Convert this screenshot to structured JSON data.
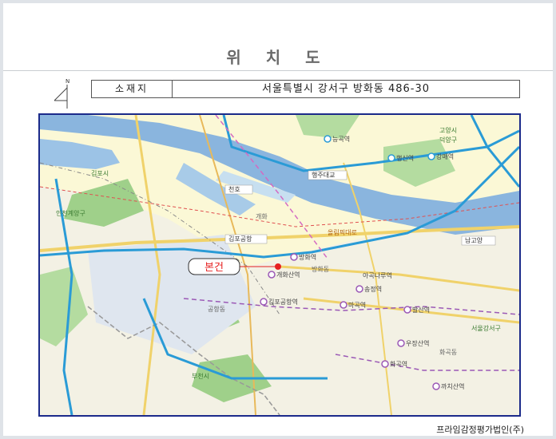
{
  "header": {
    "title": "위 치 도"
  },
  "location": {
    "label": "소재지",
    "address": "서울특별시 강서구 방화동 486-30"
  },
  "north_arrow": {
    "letter": "N",
    "icon": "north-arrow-icon"
  },
  "map": {
    "subject_label": "본건",
    "roads": {
      "olympic": "올림픽대로",
      "haengju_bridge": "행주대교",
      "namgoyang": "남고양",
      "gimpo_airport_ic": "김포공항",
      "cheonho": "천호"
    },
    "stations": [
      "방화역",
      "개화산역",
      "김포공항역",
      "송정역",
      "마곡역",
      "발산역",
      "아곡나루역",
      "우장산역",
      "화곡역",
      "까치산역",
      "능곡역",
      "행신역",
      "강매역"
    ],
    "places": {
      "seoul_gangseo": "서울강서구",
      "incheon_gyeyang": "인천계양구",
      "bucheon": "부천시",
      "gimpo": "김포시",
      "goyang": "고양시",
      "deokyang": "덕양구",
      "gaehwa": "개화",
      "gongamdong": "공항동",
      "hwagok": "화곡동",
      "banghwa": "방화동"
    },
    "colors": {
      "river": "#8ab5de",
      "river_dark": "#6a9bd0",
      "land": "#f3f1e4",
      "green": "#9fd08a",
      "subway_blue": "#2a9bd6",
      "subway_purple": "#9b59b6",
      "road_main": "#f0d26a",
      "road_red": "#e05050",
      "subject_marker": "#e62020"
    }
  },
  "footer": {
    "company": "프라임감정평가법인(주)"
  }
}
